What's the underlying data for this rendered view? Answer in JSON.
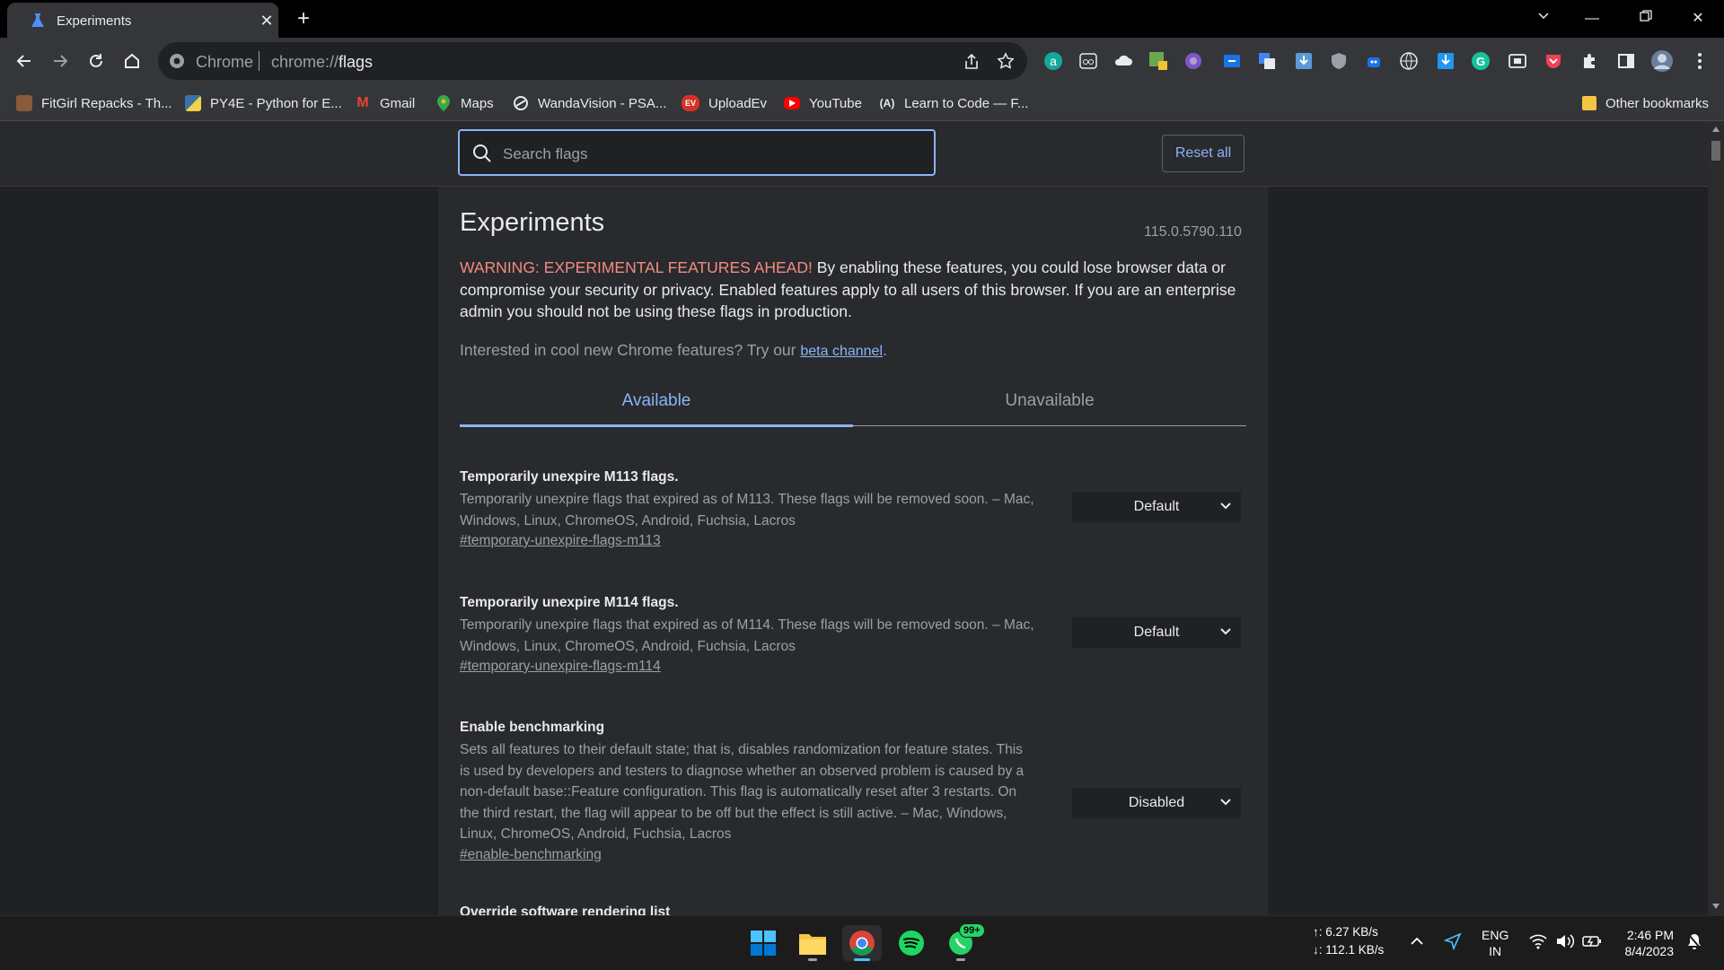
{
  "browser": {
    "tab_title": "Experiments",
    "omnibox_scheme_label": "Chrome",
    "url_prefix": "chrome://",
    "url_host": "flags"
  },
  "bookmarks": [
    {
      "label": "FitGirl Repacks - Th...",
      "icon": "fitgirl-icon",
      "color": "#8a5a3c"
    },
    {
      "label": "PY4E - Python for E...",
      "icon": "python-icon",
      "color": "#3b73a8"
    },
    {
      "label": "Gmail",
      "icon": "gmail-icon",
      "color": "#ea4335"
    },
    {
      "label": "Maps",
      "icon": "maps-icon",
      "color": "#34a853"
    },
    {
      "label": "WandaVision - PSA...",
      "icon": "psa-icon",
      "color": "#e8eaed"
    },
    {
      "label": "UploadEv",
      "icon": "uploadev-icon",
      "color": "#d93025"
    },
    {
      "label": "YouTube",
      "icon": "youtube-icon",
      "color": "#ff0000"
    },
    {
      "label": "Learn to Code — F...",
      "icon": "freecodecamp-icon",
      "color": "#e8eaed"
    }
  ],
  "other_bookmarks": "Other bookmarks",
  "header": {
    "search_placeholder": "Search flags",
    "reset_label": "Reset all"
  },
  "page": {
    "title": "Experiments",
    "version": "115.0.5790.110",
    "warning_prefix": "WARNING: EXPERIMENTAL FEATURES AHEAD!",
    "warning_text": " By enabling these features, you could lose browser data or compromise your security or privacy. Enabled features apply to all users of this browser. If you are an enterprise admin you should not be using these flags in production.",
    "interest_text": "Interested in cool new Chrome features? Try our ",
    "beta_link": "beta channel",
    "interest_suffix": ".",
    "tabs": [
      "Available",
      "Unavailable"
    ]
  },
  "flags": [
    {
      "name": "Temporarily unexpire M113 flags.",
      "description": "Temporarily unexpire flags that expired as of M113. These flags will be removed soon. – Mac, Windows, Linux, ChromeOS, Android, Fuchsia, Lacros",
      "link": "#temporary-unexpire-flags-m113",
      "value": "Default"
    },
    {
      "name": "Temporarily unexpire M114 flags.",
      "description": "Temporarily unexpire flags that expired as of M114. These flags will be removed soon. – Mac, Windows, Linux, ChromeOS, Android, Fuchsia, Lacros",
      "link": "#temporary-unexpire-flags-m114",
      "value": "Default"
    },
    {
      "name": "Enable benchmarking",
      "description": "Sets all features to their default state; that is, disables randomization for feature states. This is used by developers and testers to diagnose whether an observed problem is caused by a non-default base::Feature configuration. This flag is automatically reset after 3 restarts. On the third restart, the flag will appear to be off but the effect is still active. – Mac, Windows, Linux, ChromeOS, Android, Fuchsia, Lacros",
      "link": "#enable-benchmarking",
      "value": "Disabled"
    },
    {
      "name": "Override software rendering list"
    }
  ],
  "taskbar": {
    "net_up": "↑: 6.27 KB/s",
    "net_down": "↓: 112.1 KB/s",
    "lang_top": "ENG",
    "lang_bottom": "IN",
    "time": "2:46 PM",
    "date": "8/4/2023",
    "whatsapp_badge": "99+"
  }
}
